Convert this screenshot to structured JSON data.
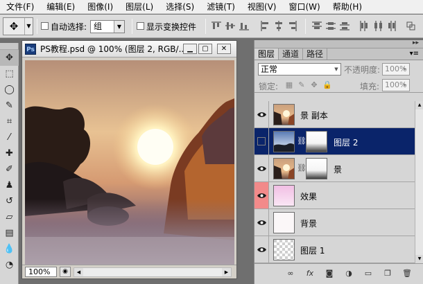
{
  "menu": [
    "文件(F)",
    "编辑(E)",
    "图像(I)",
    "图层(L)",
    "选择(S)",
    "滤镜(T)",
    "视图(V)",
    "窗口(W)",
    "帮助(H)"
  ],
  "options": {
    "auto_select_label": "自动选择:",
    "auto_select_value": "组",
    "transform_label": "显示变换控件"
  },
  "tools": [
    {
      "name": "move-tool",
      "glyph": "✥"
    },
    {
      "name": "marquee-tool",
      "glyph": "⬚"
    },
    {
      "name": "lasso-tool",
      "glyph": "◯"
    },
    {
      "name": "quick-select-tool",
      "glyph": "✎"
    },
    {
      "name": "crop-tool",
      "glyph": "⌗"
    },
    {
      "name": "eyedropper-tool",
      "glyph": "⁄"
    },
    {
      "name": "healing-brush-tool",
      "glyph": "✚"
    },
    {
      "name": "brush-tool",
      "glyph": "✐"
    },
    {
      "name": "clone-stamp-tool",
      "glyph": "♟"
    },
    {
      "name": "history-brush-tool",
      "glyph": "↺"
    },
    {
      "name": "eraser-tool",
      "glyph": "▱"
    },
    {
      "name": "gradient-tool",
      "glyph": "▤"
    },
    {
      "name": "blur-tool",
      "glyph": "💧"
    },
    {
      "name": "dodge-tool",
      "glyph": "◔"
    }
  ],
  "document": {
    "title": "PS教程.psd @ 100% (图层 2, RGB/...",
    "zoom": "100%"
  },
  "layers_panel": {
    "tabs": [
      "图层",
      "通道",
      "路径"
    ],
    "blend_mode": "正常",
    "opacity_label": "不透明度:",
    "opacity_value": "100%",
    "lock_label": "锁定:",
    "fill_label": "填充:",
    "fill_value": "100%",
    "layers": [
      {
        "name": "景 副本",
        "visible": true,
        "selected": false,
        "mask": false,
        "thumb": "sunset"
      },
      {
        "name": "图层 2",
        "visible": false,
        "selected": true,
        "mask": true,
        "thumb": "dusk"
      },
      {
        "name": "景",
        "visible": true,
        "selected": false,
        "mask": true,
        "thumb": "sunset"
      },
      {
        "name": "效果",
        "visible": true,
        "selected": false,
        "mask": false,
        "thumb": "pink",
        "eye_highlight": true
      },
      {
        "name": "背景",
        "visible": true,
        "selected": false,
        "mask": false,
        "thumb": "white"
      },
      {
        "name": "图层 1",
        "visible": true,
        "selected": false,
        "mask": false,
        "thumb": "transparent"
      }
    ]
  },
  "colors": {
    "selection": "#0a246a",
    "highlight_eye": "#f28a8a"
  }
}
